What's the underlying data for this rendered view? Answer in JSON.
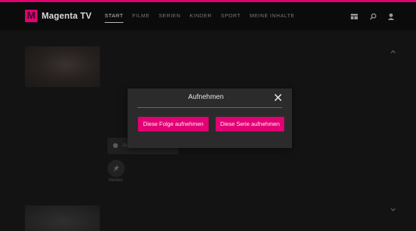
{
  "header": {
    "logo_letter": "M",
    "brand": "Magenta TV",
    "nav": [
      {
        "label": "START",
        "active": true
      },
      {
        "label": "FILME",
        "active": false
      },
      {
        "label": "SERIEN",
        "active": false
      },
      {
        "label": "KINDER",
        "active": false
      },
      {
        "label": "SPORT",
        "active": false
      },
      {
        "label": "MEINE INHALTE",
        "active": false
      }
    ],
    "icons": [
      "guide-icon",
      "search-icon",
      "profile-icon"
    ]
  },
  "background": {
    "record_button_label": "Au",
    "pin_label": "Merken",
    "chevrons": [
      "chevron-up-icon",
      "chevron-down-icon"
    ]
  },
  "modal": {
    "title": "Aufnehmen",
    "episode_button": "Diese Folge aufnehmen",
    "series_button": "Diese Serie aufnehmen",
    "close_icon": "close-icon"
  },
  "colors": {
    "accent": "#e20074",
    "modal_bg": "#2b2b2b",
    "page_bg": "#121212"
  }
}
